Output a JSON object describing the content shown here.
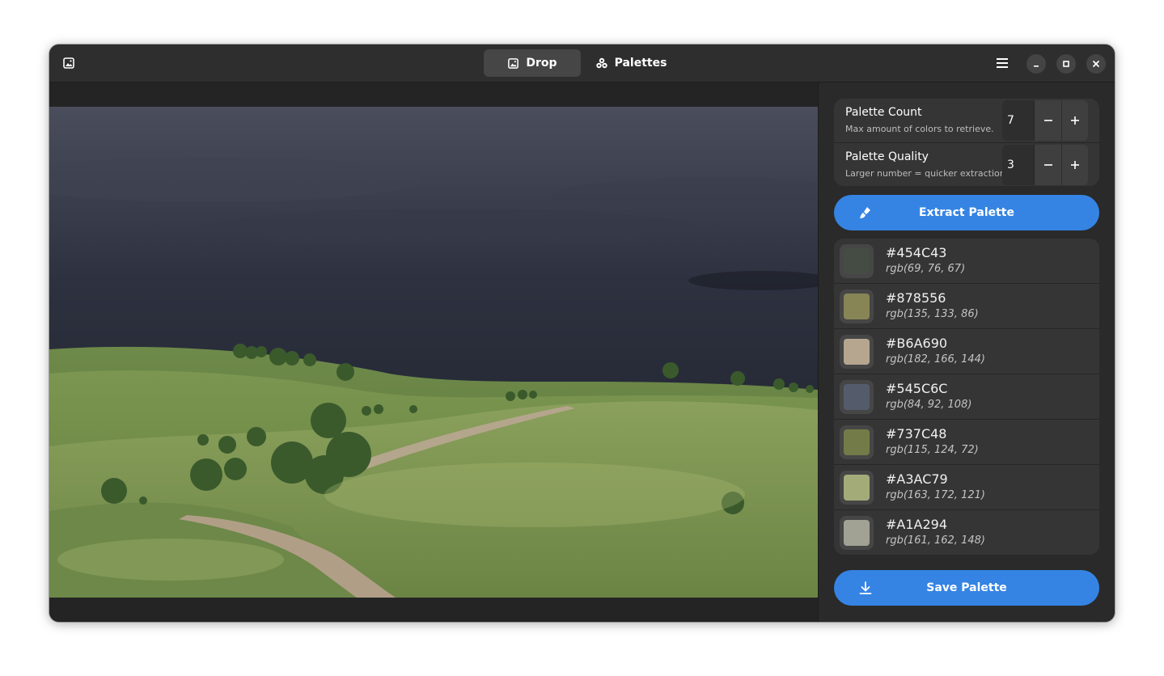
{
  "tabs": [
    {
      "label": "Drop",
      "icon": "image-icon",
      "active": true
    },
    {
      "label": "Palettes",
      "icon": "palette-icon",
      "active": false
    }
  ],
  "settings": {
    "palette_count": {
      "title": "Palette Count",
      "subtitle": "Max amount of colors to retrieve.",
      "value": "7"
    },
    "palette_quality": {
      "title": "Palette Quality",
      "subtitle": "Larger number = quicker extraction.",
      "value": "3"
    }
  },
  "extract_button": {
    "label": "Extract Palette",
    "icon": "brush-icon"
  },
  "save_button": {
    "label": "Save Palette",
    "icon": "download-icon"
  },
  "colors": [
    {
      "hex": "#454C43",
      "rgb": "rgb(69, 76, 67)"
    },
    {
      "hex": "#878556",
      "rgb": "rgb(135, 133, 86)"
    },
    {
      "hex": "#B6A690",
      "rgb": "rgb(182, 166, 144)"
    },
    {
      "hex": "#545C6C",
      "rgb": "rgb(84, 92, 108)"
    },
    {
      "hex": "#737C48",
      "rgb": "rgb(115, 124, 72)"
    },
    {
      "hex": "#A3AC79",
      "rgb": "rgb(163, 172, 121)"
    },
    {
      "hex": "#A1A294",
      "rgb": "rgb(161, 162, 148)"
    }
  ],
  "theme": {
    "accent": "#3584e4",
    "window_bg": "#242424",
    "headerbar_bg": "#2e2e2e"
  }
}
